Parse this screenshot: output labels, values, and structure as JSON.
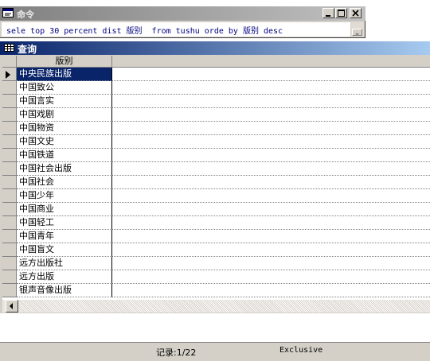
{
  "command_window": {
    "title": "命令",
    "command_text": "sele top 30 percent dist 版别  from tushu orde by 版别 desc"
  },
  "browse_window": {
    "title": "查询",
    "column_header": "版别",
    "rows": [
      "中央民族出版",
      "中国致公",
      "中国言实",
      "中国戏剧",
      "中国物资",
      "中国文史",
      "中国铁道",
      "中国社会出版",
      "中国社会",
      "中国少年",
      "中国商业",
      "中国轻工",
      "中国青年",
      "中国盲文",
      "远方出版社",
      "远方出版",
      "银声音像出版"
    ],
    "selected_row": 0
  },
  "status_bar": {
    "record": "记录:1/22",
    "mode": "Exclusive"
  },
  "colors": {
    "active_title": "#0a246a",
    "inactive_title": "#808080",
    "selection": "#0a246a",
    "command_text": "#000080"
  }
}
